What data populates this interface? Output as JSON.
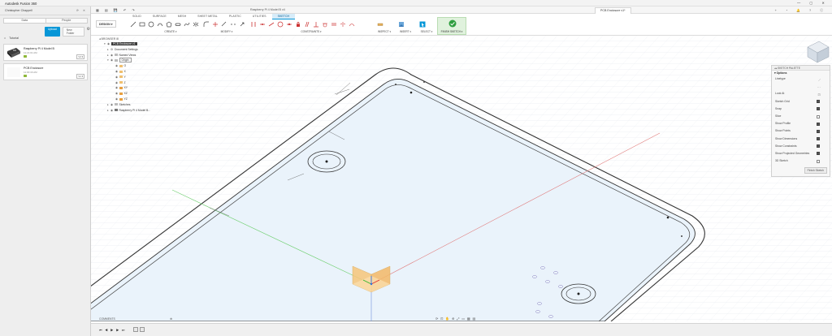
{
  "app": {
    "title": "Autodesk Fusion 360",
    "window_buttons": "—  ▢  ✕"
  },
  "left_panel": {
    "user": "Christopher Chappell",
    "user_icons": "⟳  ✕",
    "tabs": [
      "Data",
      "People"
    ],
    "upload_label": "Upload",
    "new_folder_label": "New Folder",
    "breadcrumb": "Tutorial",
    "files": [
      {
        "title": "Raspberry Pi 4 Model B",
        "time": "11:21:01 AM",
        "version": "V4 ▾"
      },
      {
        "title": "PCB Enclosure",
        "time": "11:00:16 AM",
        "version": "V1 ▾"
      }
    ]
  },
  "doc_tabs": [
    {
      "label": "Raspberry Pi 4 Model B v4",
      "active": false
    },
    {
      "label": "PCB Enclosure v1*",
      "active": true
    }
  ],
  "toolbar": {
    "workspace": "DESIGN ▾",
    "ribbon_tabs": [
      "SOLID",
      "SURFACE",
      "MESH",
      "SHEET METAL",
      "PLASTIC",
      "UTILITIES",
      "SKETCH"
    ],
    "active_ribbon_tab": "SKETCH",
    "groups": [
      "CREATE ▾",
      "MODIFY ▾",
      "CONSTRAINTS ▾",
      "INSPECT ▾",
      "INSERT ▾",
      "SELECT ▾"
    ],
    "finish_label": "FINISH SKETCH ▾"
  },
  "browser": {
    "header": "BROWSER",
    "nodes": [
      {
        "label": "PCB Enclosure v1",
        "highlight": true,
        "indent": 0
      },
      {
        "label": "Document Settings",
        "indent": 1
      },
      {
        "label": "Named Views",
        "indent": 1
      },
      {
        "label": "Origin",
        "indent": 1,
        "highlight": false,
        "boxed": true
      },
      {
        "label": "O",
        "indent": 2
      },
      {
        "label": "X",
        "indent": 2
      },
      {
        "label": "Y",
        "indent": 2
      },
      {
        "label": "Z",
        "indent": 2
      },
      {
        "label": "XY",
        "indent": 2
      },
      {
        "label": "XZ",
        "indent": 2
      },
      {
        "label": "YZ",
        "indent": 2
      },
      {
        "label": "Sketches",
        "indent": 1
      },
      {
        "label": "Raspberry Pi 4 Model B...",
        "indent": 1
      }
    ]
  },
  "palette": {
    "header": "SKETCH PALETTE",
    "section": "Options",
    "rows": [
      {
        "label": "Linetype",
        "kind": "icon"
      },
      {
        "label": "",
        "kind": "icon"
      },
      {
        "label": "Look At",
        "kind": "icon"
      },
      {
        "label": "Sketch Grid",
        "kind": "check",
        "on": true
      },
      {
        "label": "Snap",
        "kind": "check",
        "on": true
      },
      {
        "label": "Slice",
        "kind": "check",
        "on": false
      },
      {
        "label": "Show Profile",
        "kind": "check",
        "on": true
      },
      {
        "label": "Show Points",
        "kind": "check",
        "on": true
      },
      {
        "label": "Show Dimensions",
        "kind": "check",
        "on": true
      },
      {
        "label": "Show Constraints",
        "kind": "check",
        "on": true
      },
      {
        "label": "Show Projected Geometries",
        "kind": "check",
        "on": true
      },
      {
        "label": "3D Sketch",
        "kind": "check",
        "on": false
      }
    ],
    "finish_button": "Finish Sketch"
  },
  "comments": "COMMENTS",
  "colors": {
    "accent": "#0696d7",
    "sketch_fill": "#e9f3fb",
    "finish_green": "#2e9e3f"
  }
}
